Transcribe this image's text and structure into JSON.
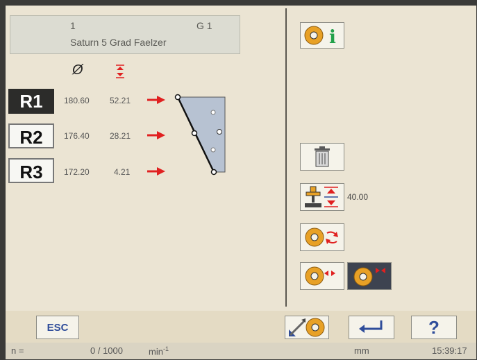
{
  "program": {
    "number": "1",
    "group": "G 1",
    "name": "Saturn 5 Grad Faelzer"
  },
  "columns": {
    "diameter_symbol": "Ø"
  },
  "rows": [
    {
      "label": "R1",
      "diameter": "180.60",
      "height": "52.21",
      "active": true
    },
    {
      "label": "R2",
      "diameter": "176.40",
      "height": "28.21",
      "active": false
    },
    {
      "label": "R3",
      "diameter": "172.20",
      "height": "4.21",
      "active": false
    }
  ],
  "tools": {
    "offset_value": "40.00"
  },
  "footer": {
    "esc_label": "ESC",
    "help_label": "?"
  },
  "status": {
    "n_label": "n =",
    "rpm": "0 / 1000",
    "rpm_unit": "min",
    "rpm_exp": "-1",
    "unit": "mm",
    "time": "15:39:17"
  },
  "colors": {
    "arrow": "#e02020",
    "tool_orange": "#e8a126",
    "accent_blue": "#2f4d9a"
  }
}
